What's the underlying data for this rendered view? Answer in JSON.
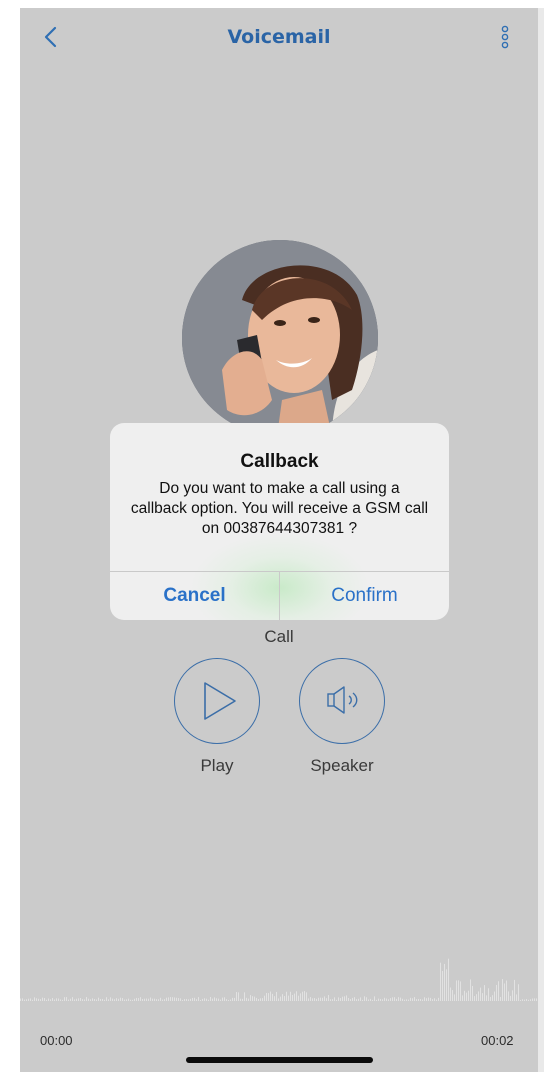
{
  "nav": {
    "title": "Voicemail"
  },
  "actions": {
    "call_label": "Call",
    "play_label": "Play",
    "speaker_label": "Speaker"
  },
  "player": {
    "start_time": "00:00",
    "end_time": "00:02"
  },
  "dialog": {
    "title": "Callback",
    "message": "Do you want to make a call using a callback option. You will receive a GSM call on 00387644307381 ?",
    "cancel_label": "Cancel",
    "confirm_label": "Confirm"
  },
  "colors": {
    "accent": "#2a64a6",
    "dialog_button": "#2a71c8",
    "background": "#cbcbcb"
  },
  "icons": [
    "chevron-left-icon",
    "more-vertical-icon",
    "play-icon",
    "speaker-icon"
  ]
}
